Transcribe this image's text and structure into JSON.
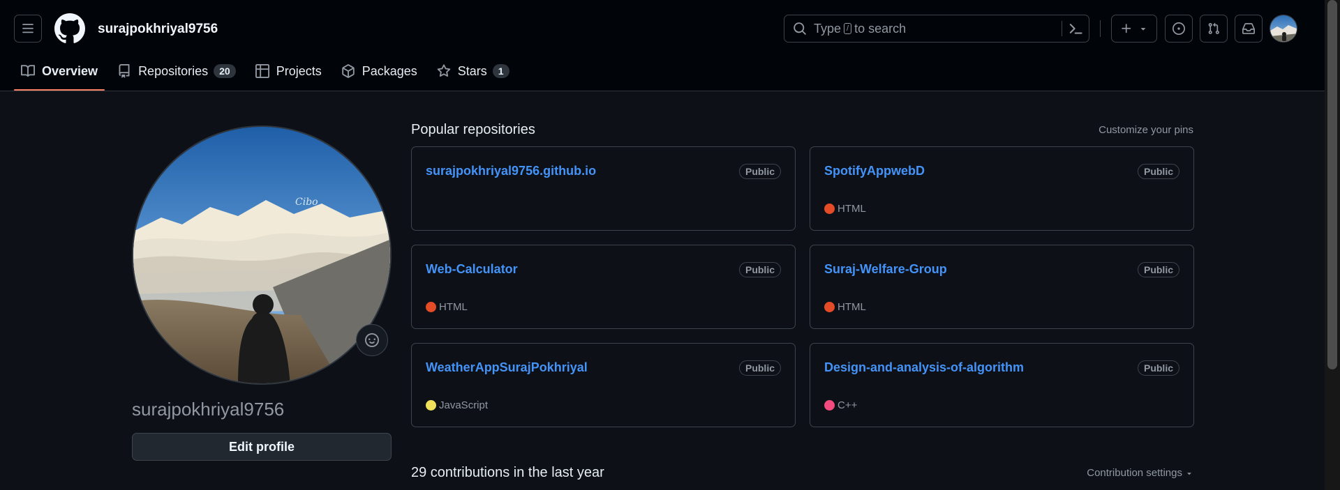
{
  "header": {
    "username": "surajpokhriyal9756",
    "search": {
      "text_before": "Type",
      "key": "/",
      "text_after": "to search"
    },
    "icons": [
      "hamburger-icon",
      "github-logo-icon",
      "search-icon",
      "command-palette-icon",
      "plus-icon",
      "chevron-down-icon",
      "issues-icon",
      "pull-requests-icon",
      "inbox-icon"
    ]
  },
  "tabs": [
    {
      "label": "Overview",
      "icon": "book-icon",
      "active": true
    },
    {
      "label": "Repositories",
      "icon": "repo-icon",
      "count": "20"
    },
    {
      "label": "Projects",
      "icon": "table-icon"
    },
    {
      "label": "Packages",
      "icon": "package-icon"
    },
    {
      "label": "Stars",
      "icon": "star-icon",
      "count": "1"
    }
  ],
  "sidebar": {
    "display_name": "surajpokhriyal9756",
    "edit_profile_label": "Edit profile"
  },
  "main": {
    "popular_title": "Popular repositories",
    "customize_label": "Customize your pins",
    "repos": [
      {
        "name": "surajpokhriyal9756.github.io",
        "visibility": "Public",
        "language": "",
        "color": ""
      },
      {
        "name": "SpotifyAppwebD",
        "visibility": "Public",
        "language": "HTML",
        "color": "#e34c26"
      },
      {
        "name": "Web-Calculator",
        "visibility": "Public",
        "language": "HTML",
        "color": "#e34c26"
      },
      {
        "name": "Suraj-Welfare-Group",
        "visibility": "Public",
        "language": "HTML",
        "color": "#e34c26"
      },
      {
        "name": "WeatherAppSurajPokhriyal",
        "visibility": "Public",
        "language": "JavaScript",
        "color": "#f1e05a"
      },
      {
        "name": "Design-and-analysis-of-algorithm",
        "visibility": "Public",
        "language": "C++",
        "color": "#f34b7d"
      }
    ],
    "contributions_title": "29 contributions in the last year",
    "contribution_settings_label": "Contribution settings"
  },
  "colors": {
    "accent_underline": "#f78166",
    "link": "#4493f8",
    "background": "#0d1117",
    "header_bg": "#010409"
  }
}
